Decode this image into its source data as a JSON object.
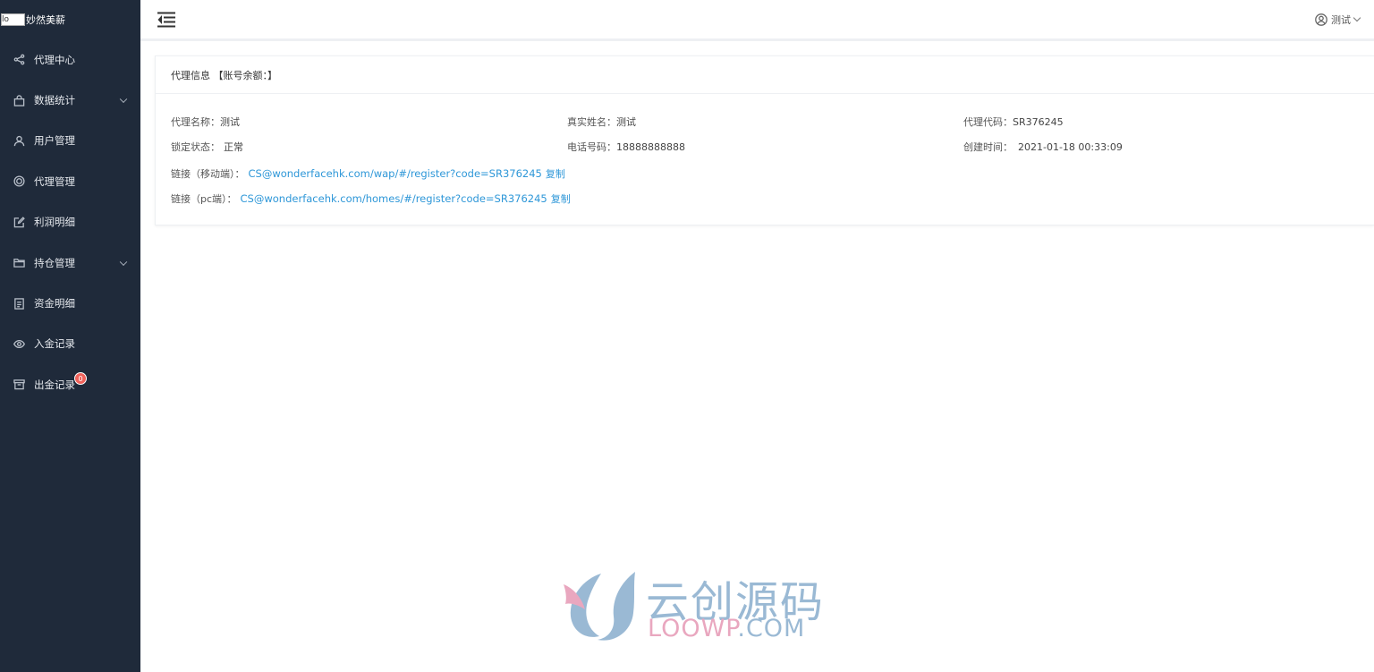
{
  "brand": {
    "logo_alt": "lo",
    "name": "妙然美薪"
  },
  "sidebar": {
    "items": [
      {
        "label": "代理中心",
        "icon": "share-icon",
        "has_arrow": false
      },
      {
        "label": "数据统计",
        "icon": "bag-icon",
        "has_arrow": true
      },
      {
        "label": "用户管理",
        "icon": "user-icon",
        "has_arrow": false
      },
      {
        "label": "代理管理",
        "icon": "target-icon",
        "has_arrow": false
      },
      {
        "label": "利润明细",
        "icon": "edit-icon",
        "has_arrow": false
      },
      {
        "label": "持仓管理",
        "icon": "folder-icon",
        "has_arrow": true
      },
      {
        "label": "资金明细",
        "icon": "document-icon",
        "has_arrow": false
      },
      {
        "label": "入金记录",
        "icon": "eye-icon",
        "has_arrow": false
      },
      {
        "label": "出金记录",
        "icon": "archive-icon",
        "has_arrow": false,
        "badge": "0"
      }
    ]
  },
  "header": {
    "user_name": "测试"
  },
  "card": {
    "title": "代理信息 【账号余额：】",
    "agent_name_label": "代理名称：",
    "agent_name": "测试",
    "real_name_label": "真实姓名：",
    "real_name": "测试",
    "agent_code_label": "代理代码：",
    "agent_code": "SR376245",
    "lock_status_label": "锁定状态：",
    "lock_status": "正常",
    "phone_label": "电话号码：",
    "phone": "18888888888",
    "created_label": "创建时间：",
    "created": "2021-01-18 00:33:09",
    "mobile_link_label": "链接（移动端）：",
    "mobile_link": "CS@wonderfacehk.com/wap/#/register?code=SR376245",
    "pc_link_label": "链接（pc端）：",
    "pc_link": "CS@wonderfacehk.com/homes/#/register?code=SR376245",
    "copy_label": "复制"
  },
  "watermark": {
    "cn": "云创源码",
    "en_part1": "LOOWP",
    "en_part2": ".COM"
  },
  "colors": {
    "sidebar_bg": "#1f2a3a",
    "link": "#2e97d8",
    "badge": "#f0625b"
  }
}
